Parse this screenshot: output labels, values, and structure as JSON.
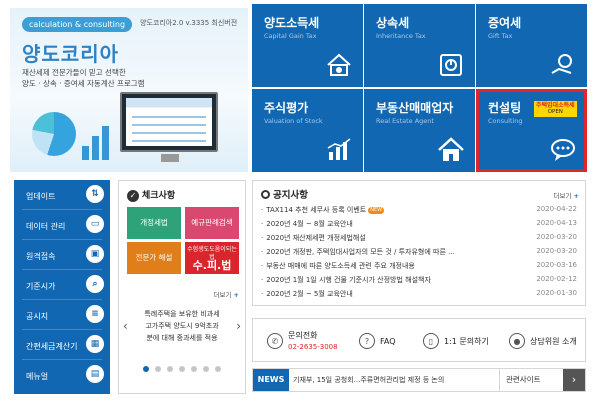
{
  "banner": {
    "pill": "calculation & consulting",
    "version": "양도코리아2.0 v.3335 최신버전",
    "logo": "양도코리아",
    "desc_line1": "재산세제 전문가들이 믿고 선택한",
    "desc_line2": "양도 · 상속 · 증여세 자동계산 프로그램"
  },
  "tiles": [
    {
      "title": "양도소득세",
      "subtitle": "Capital Gain Tax",
      "icon": "house-wallet-icon"
    },
    {
      "title": "상속세",
      "subtitle": "Inheritance Tax",
      "icon": "safe-icon"
    },
    {
      "title": "증여세",
      "subtitle": "Gift Tax",
      "icon": "gift-hand-icon"
    },
    {
      "title": "주식평가",
      "subtitle": "Valuation of Stock",
      "icon": "bar-chart-icon"
    },
    {
      "title": "부동산매매업자",
      "subtitle": "Real Estate Agent",
      "icon": "home-icon"
    },
    {
      "title": "컨설팅",
      "subtitle": "Consulting",
      "icon": "speech-bubble-icon",
      "badge_line1": "주택임대소득세",
      "badge_line2": "OPEN"
    }
  ],
  "side_menu": [
    {
      "label": "업데이트",
      "icon": "update-arrows-icon",
      "glyph": "⇅"
    },
    {
      "label": "데이터 관리",
      "icon": "folder-icon",
      "glyph": "▭"
    },
    {
      "label": "원격접속",
      "icon": "remote-monitor-icon",
      "glyph": "▣"
    },
    {
      "label": "기준시가",
      "icon": "search-icon",
      "glyph": "⌕"
    },
    {
      "label": "공시지",
      "icon": "document-icon",
      "glyph": "≡"
    },
    {
      "label": "간편세금계산기",
      "icon": "calculator-icon",
      "glyph": "▦"
    },
    {
      "label": "메뉴얼",
      "icon": "book-icon",
      "glyph": "▤"
    }
  ],
  "checklist": {
    "title": "체크사항",
    "buttons": [
      {
        "label": "개정세법",
        "color": "#2ea37a"
      },
      {
        "label": "예규판례검색",
        "color": "#d9496f"
      },
      {
        "label": "전문가 해설",
        "color": "#e07f1a"
      },
      {
        "label_small": "수험생도도움이되는법",
        "label_big": "수.피.법",
        "color": "#d9252b"
      }
    ],
    "more": "더보기",
    "text_line1": "특례주택을 보유한 비과세",
    "text_line2": "고가주택 양도시 9억초과",
    "text_line3": "분에 대해 중과세를 적용"
  },
  "notice": {
    "title": "공지사항",
    "more": "더보기",
    "items": [
      {
        "title": "TAX114 추천 세무사 등록 이벤트",
        "date": "2020-04-22",
        "new": "NEW"
      },
      {
        "title": "2020년 4월 ~ 8월 교육안내",
        "date": "2020-04-13"
      },
      {
        "title": "2020년 재산제세편 개정세법해설",
        "date": "2020-03-20"
      },
      {
        "title": "2020년 개정판, 주택임대사업자의 모든 것 / 투자유형에 따른 ...",
        "date": "2020-03-20"
      },
      {
        "title": "부동산 매매에 따른 양도소득세 관련 주요 개정내용",
        "date": "2020-03-16"
      },
      {
        "title": "2020년 1월 1일 시행 건물 기준시가 산정방법 해설책자",
        "date": "2020-02-12"
      },
      {
        "title": "2020년 2월 ~ 5월 교육안내",
        "date": "2020-01-30"
      }
    ]
  },
  "contact": {
    "phone_label": "문의전화",
    "phone_number": "02-2635-3008",
    "faq": "FAQ",
    "inquiry": "1:1 문의하기",
    "counselor": "상담위원 소개"
  },
  "news": {
    "label": "NEWS",
    "text": "기재부, 15일 공청회...주류면허관리법 제정 등 논의",
    "select": "관련사이트",
    "arrow": "›"
  },
  "colors": {
    "primary": "#1167b1",
    "highlight": "#e0252c"
  }
}
